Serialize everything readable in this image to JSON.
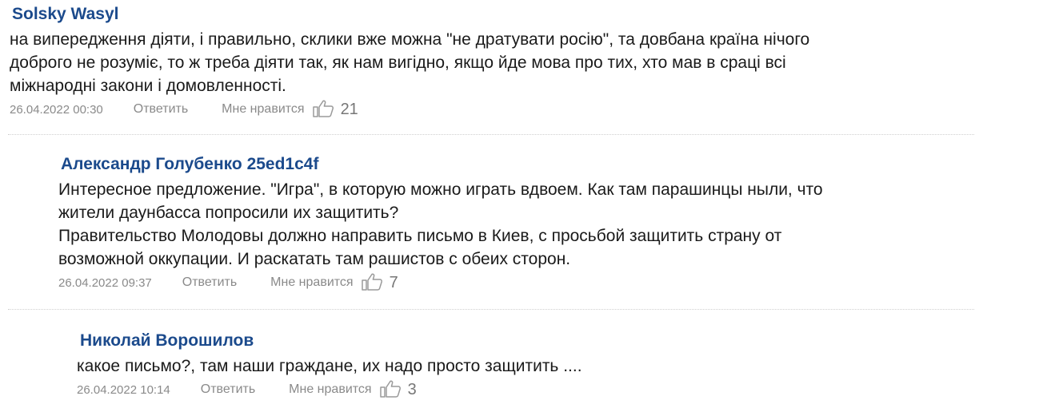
{
  "comments": [
    {
      "author": "Solsky Wasyl",
      "text_lines": [
        "на випередження діяти, і правильно, склики вже можна \"не дратувати росію\", та довбана країна нічого",
        "доброго не розуміє, то ж треба діяти так, як нам вигідно, якщо йде мова про тих, хто мав в сраці всі",
        "міжнародні закони і домовленності."
      ],
      "date": "26.04.2022 00:30",
      "reply_label": "Ответить",
      "like_label": "Мне нравится",
      "like_icon": "thumbs-up-icon",
      "likes": "21"
    },
    {
      "author": "Александр Голубенко 25ed1c4f",
      "text_lines": [
        "Интересное предложение. \"Игра\", в которую можно играть вдвоем. Как там парашинцы ныли, что",
        "жители даунбасса попросили их защитить?",
        "Правительство Молодовы должно направить письмо в Киев, с просьбой защитить страну от",
        "возможной оккупации. И раскатать там рашистов с обеих сторон."
      ],
      "date": "26.04.2022 09:37",
      "reply_label": "Ответить",
      "like_label": "Мне нравится",
      "like_icon": "thumbs-up-icon",
      "likes": "7"
    },
    {
      "author": "Николай Ворошилов",
      "text_lines": [
        "какое письмо?, там наши граждане, их надо просто защитить ...."
      ],
      "date": "26.04.2022 10:14",
      "reply_label": "Ответить",
      "like_label": "Мне нравится",
      "like_icon": "thumbs-up-icon",
      "likes": "3"
    }
  ],
  "colors": {
    "author": "#1b4a8c",
    "text": "#1a1a1a",
    "meta": "#8a8a8a",
    "divider": "#d0d0d0"
  }
}
